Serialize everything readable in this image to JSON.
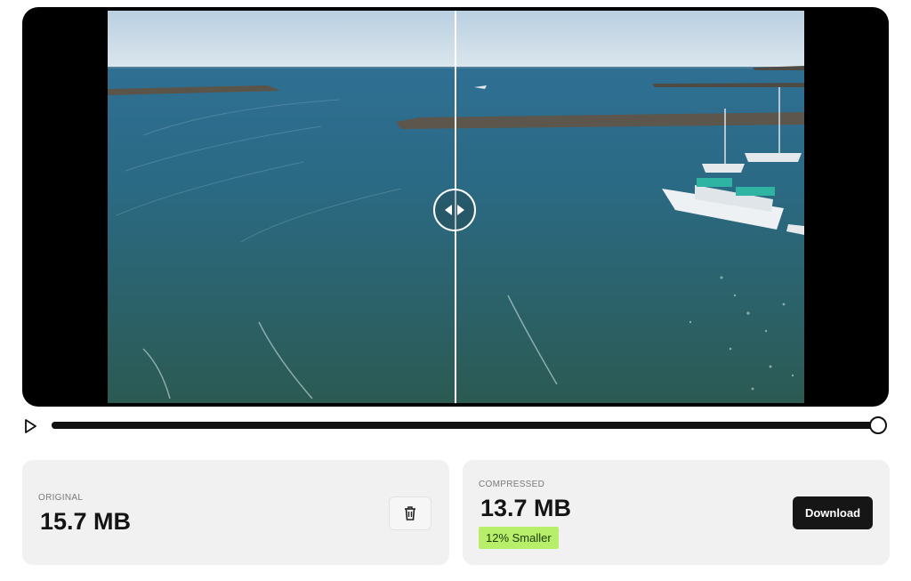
{
  "player": {
    "comparison_position": 0.5,
    "progress": 1.0
  },
  "original": {
    "label": "ORIGINAL",
    "size": "15.7 MB"
  },
  "compressed": {
    "label": "COMPRESSED",
    "size": "13.7 MB",
    "badge": "12% Smaller",
    "download_label": "Download"
  },
  "colors": {
    "badge_bg": "#b7ef6b",
    "button_dark": "#161616",
    "card_bg": "#f1f1f1"
  },
  "icons": {
    "play": "play-icon",
    "trash": "trash-icon",
    "compare_handle": "left-right-arrows-icon"
  }
}
